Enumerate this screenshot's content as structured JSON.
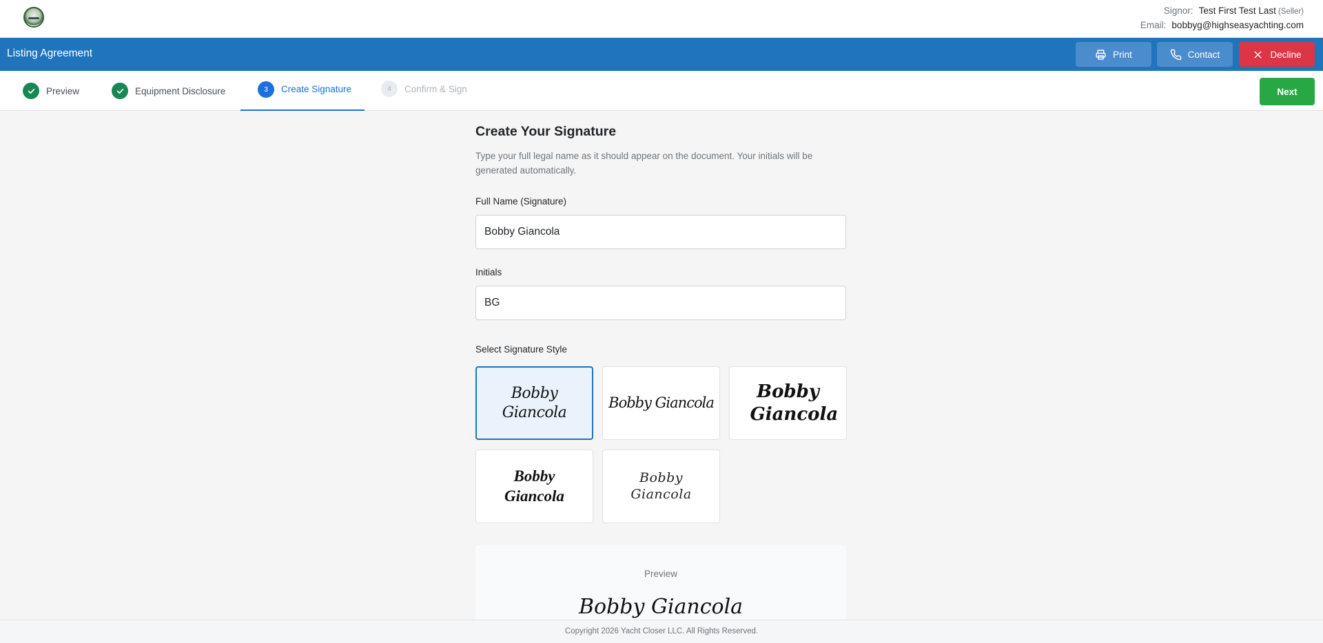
{
  "header": {
    "signor_label": "Signor:",
    "signor_name": "Test First Test Last",
    "signor_role": "(Seller)",
    "email_label": "Email:",
    "email_value": "bobbyg@highseasyachting.com"
  },
  "toolbar": {
    "title": "Listing Agreement",
    "print_label": "Print",
    "contact_label": "Contact",
    "decline_label": "Decline"
  },
  "steps": [
    {
      "number": "",
      "label": "Preview",
      "state": "done"
    },
    {
      "number": "",
      "label": "Equipment Disclosure",
      "state": "done"
    },
    {
      "number": "3",
      "label": "Create Signature",
      "state": "active"
    },
    {
      "number": "4",
      "label": "Confirm & Sign",
      "state": "todo"
    }
  ],
  "next_label": "Next",
  "form": {
    "heading": "Create Your Signature",
    "instructions": "Type your full legal name as it should appear on the document. Your initials will be generated automatically.",
    "full_name_label": "Full Name (Signature)",
    "full_name_value": "Bobby Giancola",
    "initials_label": "Initials",
    "initials_value": "BG",
    "style_label": "Select Signature Style",
    "styles": [
      {
        "text": "Bobby Giancola",
        "selected": true
      },
      {
        "text": "Bobby Giancola",
        "selected": false
      },
      {
        "text": "Bobby Giancola",
        "selected": false
      },
      {
        "text": "Bobby Giancola",
        "selected": false
      },
      {
        "text": "Bobby Giancola",
        "selected": false
      }
    ],
    "preview_label": "Preview",
    "preview_text": "Bobby Giancola"
  },
  "footer": {
    "copyright": "Copyright 2026 Yacht Closer LLC. All Rights Reserved."
  },
  "colors": {
    "primary_blue": "#1f74bb",
    "success_green": "#28a745",
    "danger_red": "#dc3545",
    "active_step": "#1d6fe0"
  }
}
